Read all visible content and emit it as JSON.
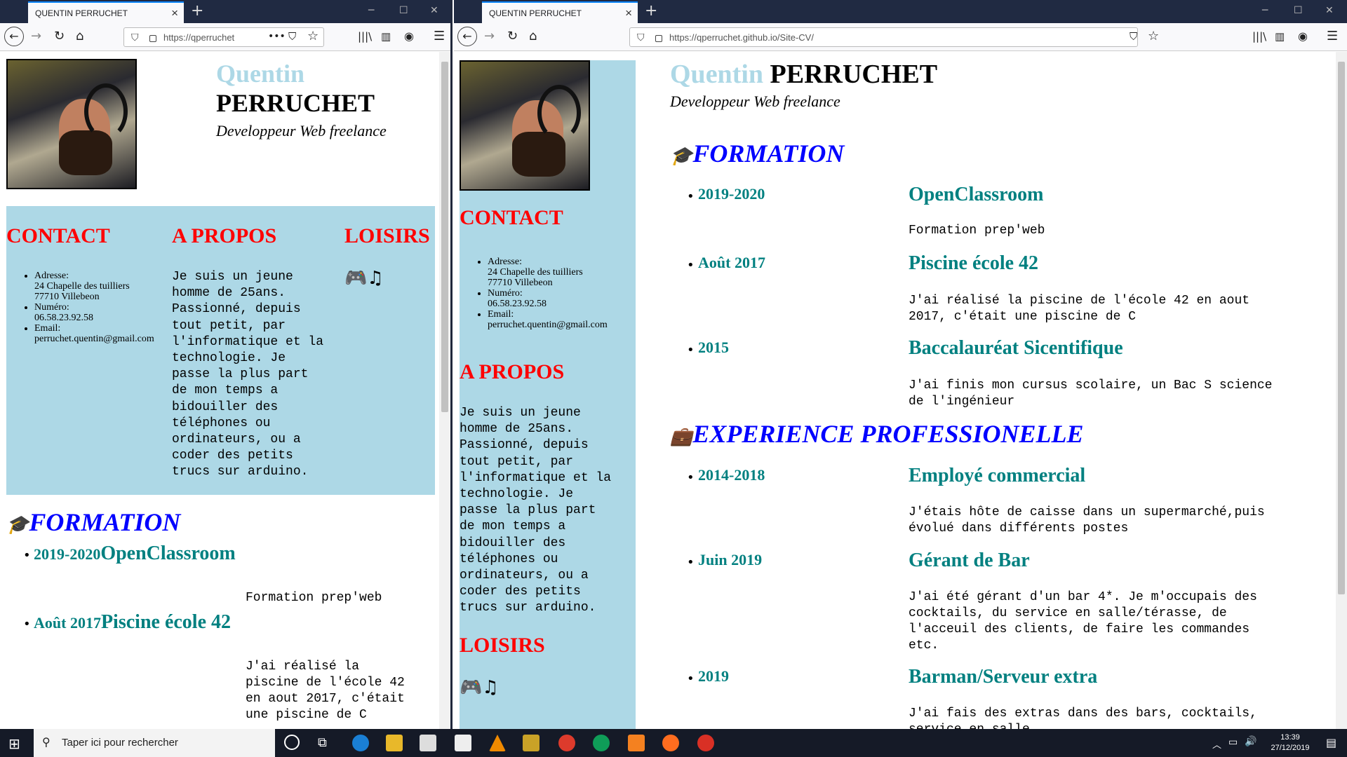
{
  "left_window": {
    "tab_title": "QUENTIN PERRUCHET",
    "url": "https://qperruchet"
  },
  "right_window": {
    "tab_title": "QUENTIN PERRUCHET",
    "url": "https://qperruchet.github.io/Site-CV/"
  },
  "cv": {
    "first_name": "Quentin",
    "last_name": "PERRUCHET",
    "job_title": "Developpeur Web freelance",
    "contact_heading": "CONTACT",
    "contact": [
      {
        "label": "Adresse:",
        "lines": [
          "24 Chapelle des tuilliers",
          "77710 Villebeon"
        ]
      },
      {
        "label": "Numéro:",
        "lines": [
          "06.58.23.92.58"
        ]
      },
      {
        "label": "Email:",
        "lines": [
          "perruchet.quentin@gmail.com"
        ]
      }
    ],
    "about_heading": "A PROPOS",
    "about_left": [
      "Je suis un jeune",
      "homme de 25ans.",
      "Passionné, depuis",
      "tout petit, par",
      "l'informatique et la",
      "technologie. Je",
      "passe la plus part",
      "de mon temps a",
      "bidouiller des",
      "téléphones ou",
      "ordinateurs, ou a",
      "coder des petits",
      "trucs sur arduino."
    ],
    "about_right": [
      "Je suis un jeune",
      "homme de 25ans.",
      "Passionné, depuis",
      "tout petit, par",
      "l'informatique et la",
      "technologie. Je",
      "passe la plus part",
      "de mon temps a",
      "bidouiller des",
      "téléphones ou",
      "ordinateurs, ou a",
      "coder des petits",
      "trucs sur arduino."
    ],
    "hobbies_heading": "LOISIRS",
    "formation_heading": "FORMATION",
    "formation": [
      {
        "date": "2019-2020",
        "title": "OpenClassroom",
        "desc": [
          "Formation prep'web"
        ]
      },
      {
        "date": "Août 2017",
        "title": "Piscine école 42",
        "desc": [
          "J'ai réalisé la piscine de l'école 42 en aout",
          "2017, c'était une piscine de C"
        ]
      },
      {
        "date": "2015",
        "title": "Baccalauréat Sicentifique",
        "desc": [
          "J'ai finis mon cursus scolaire, un Bac S science",
          "de l'ingénieur"
        ]
      }
    ],
    "formation_left_desc2": [
      "J'ai réalisé la",
      "piscine de l'école 42",
      "en aout 2017, c'était",
      "une piscine de C"
    ],
    "experience_heading": "EXPERIENCE PROFESSIONELLE",
    "experience": [
      {
        "date": "2014-2018",
        "title": "Employé commercial",
        "desc": [
          "J'étais hôte de caisse dans un supermarché,puis",
          "évolué dans différents postes"
        ]
      },
      {
        "date": "Juin 2019",
        "title": "Gérant de Bar",
        "desc": [
          "J'ai été gérant d'un bar 4*. Je m'occupais des",
          "cocktails, du service en salle/térasse, de",
          "l'acceuil des clients, de faire les commandes",
          "etc."
        ]
      },
      {
        "date": "2019",
        "title": "Barman/Serveur extra",
        "desc": [
          "J'ai fais des extras dans des bars, cocktails,",
          "service en salle"
        ]
      }
    ]
  },
  "taskbar": {
    "search_placeholder": "Taper ici pour rechercher",
    "time": "13:39",
    "date": "27/12/2019"
  }
}
